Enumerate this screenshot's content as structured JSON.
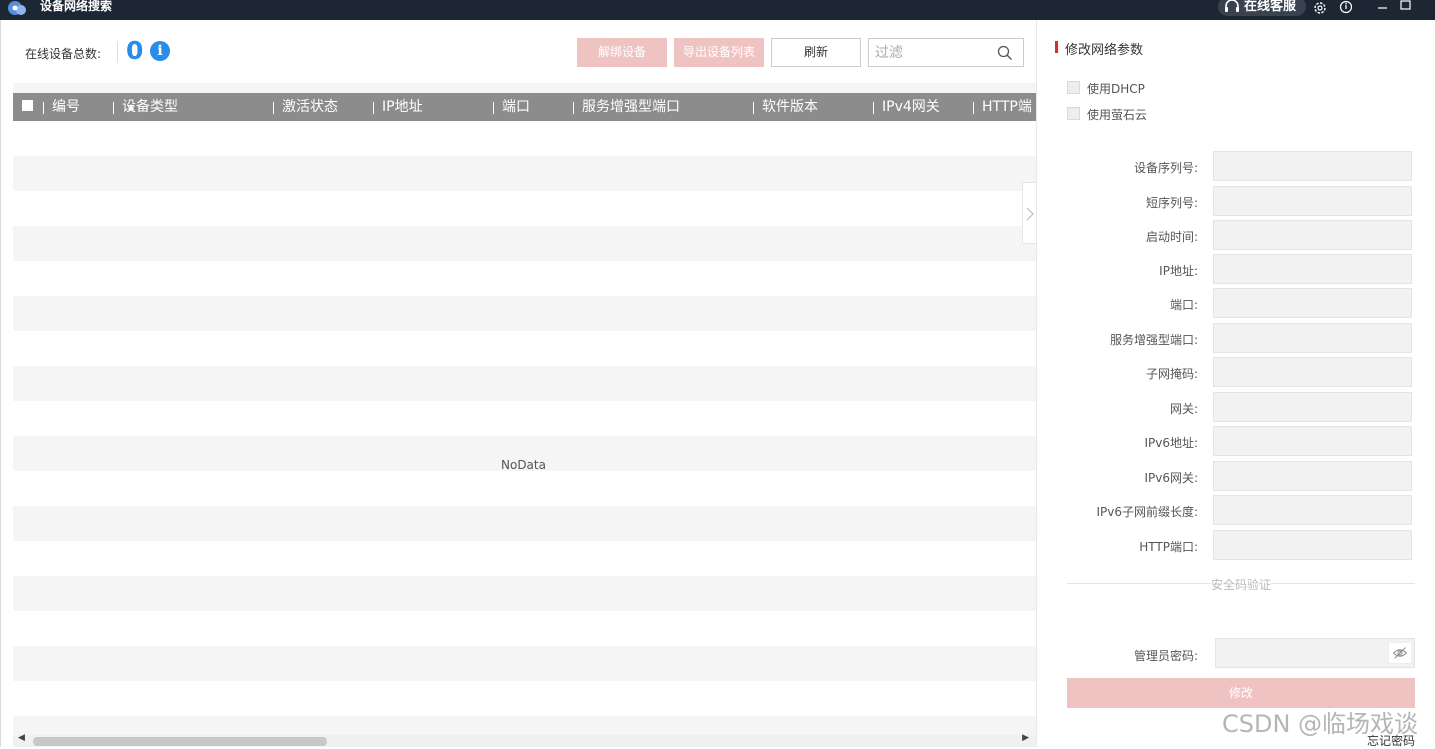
{
  "window": {
    "title": "设备网络搜索",
    "support_label": "在线客服"
  },
  "toolbar": {
    "online_count_label": "在线设备总数:",
    "online_count_value": "0",
    "deactivate_label": "解绑设备",
    "export_label": "导出设备列表",
    "refresh_label": "刷新",
    "filter_placeholder": "过滤"
  },
  "table": {
    "columns": [
      "编号",
      "设备类型",
      "激活状态",
      "IP地址",
      "端口",
      "服务增强型端口",
      "软件版本",
      "IPv4网关",
      "HTTP端"
    ],
    "empty_text": "NoData"
  },
  "panel": {
    "title": "修改网络参数",
    "checkboxes": [
      "使用DHCP",
      "使用萤石云"
    ],
    "fields": [
      "设备序列号:",
      "短序列号:",
      "启动时间:",
      "IP地址:",
      "端口:",
      "服务增强型端口:",
      "子网掩码:",
      "网关:",
      "IPv6地址:",
      "IPv6网关:",
      "IPv6子网前缀长度:",
      "HTTP端口:"
    ],
    "security_label": "安全码验证",
    "password_label": "管理员密码:",
    "modify_label": "修改",
    "forgot_label": "忘记密码"
  },
  "watermark": "CSDN @临场戏谈",
  "colors": {
    "titlebar": "#1d2633",
    "accent_blue": "#2a8cea",
    "disabled_red": "#f0c3c3",
    "title_mark": "#e02a2a",
    "header_gray": "#8c8c8c"
  },
  "icons": [
    "app-icon",
    "headset-icon",
    "settings-icon",
    "about-icon",
    "minimize-icon",
    "maximize-icon",
    "info-icon",
    "search-icon",
    "sort-asc-icon",
    "chevron-right-icon",
    "eye-off-icon"
  ]
}
